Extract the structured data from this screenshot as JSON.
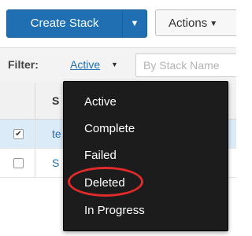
{
  "toolbar": {
    "create_label": "Create Stack",
    "actions_label": "Actions",
    "caret_glyph": "▼"
  },
  "filter": {
    "label": "Filter:",
    "value": "Active",
    "search_placeholder": "By Stack Name"
  },
  "table": {
    "header_label": "S",
    "rows": [
      {
        "checked": true,
        "name": "te",
        "checkbox_glyph": "✔"
      },
      {
        "checked": false,
        "name": "S",
        "checkbox_glyph": ""
      }
    ]
  },
  "dropdown": {
    "items": [
      "Active",
      "Complete",
      "Failed",
      "Deleted",
      "In Progress"
    ],
    "highlighted": "Deleted"
  },
  "colors": {
    "primary": "#1f6fb2",
    "menu_bg": "#1c1c1c",
    "highlight": "#e02b2b",
    "selected_row": "#dcebf8"
  }
}
